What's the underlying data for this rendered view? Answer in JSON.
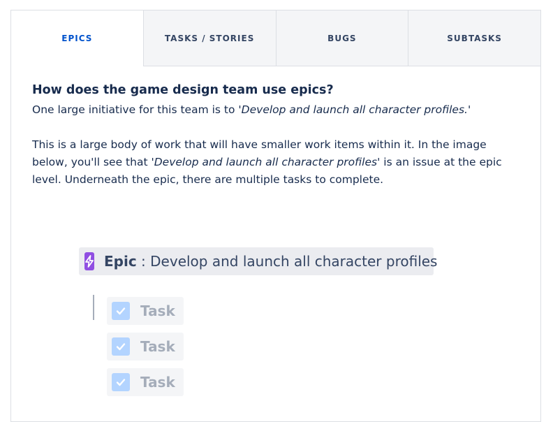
{
  "tabs": [
    {
      "label": "EPICS",
      "active": true
    },
    {
      "label": "TASKS / STORIES",
      "active": false
    },
    {
      "label": "BUGS",
      "active": false
    },
    {
      "label": "SUBTASKS",
      "active": false
    }
  ],
  "content": {
    "heading": "How does the game design team use epics?",
    "para1_prefix": "One large initiative for this team is to ",
    "para1_quote": "'Develop and launch all character profiles.'",
    "para2_prefix": "This is a large body of work that will have smaller work items within it. In the image below, you'll see that ",
    "para2_quote": "'Develop and launch all character profiles'",
    "para2_suffix": " is an issue at the epic level. Underneath the epic, there are multiple tasks to complete."
  },
  "diagram": {
    "epic": {
      "icon": "lightning-bolt-icon",
      "type_label": "Epic",
      "separator": " : ",
      "title": "Develop and launch all character profiles"
    },
    "tasks": [
      {
        "icon": "checkbox-icon",
        "label": "Task"
      },
      {
        "icon": "checkbox-icon",
        "label": "Task"
      },
      {
        "icon": "checkbox-icon",
        "label": "Task"
      }
    ]
  },
  "colors": {
    "active_tab": "#0052cc",
    "epic_icon": "#904ee2",
    "task_icon": "#b3d4ff",
    "text": "#172b4d"
  }
}
